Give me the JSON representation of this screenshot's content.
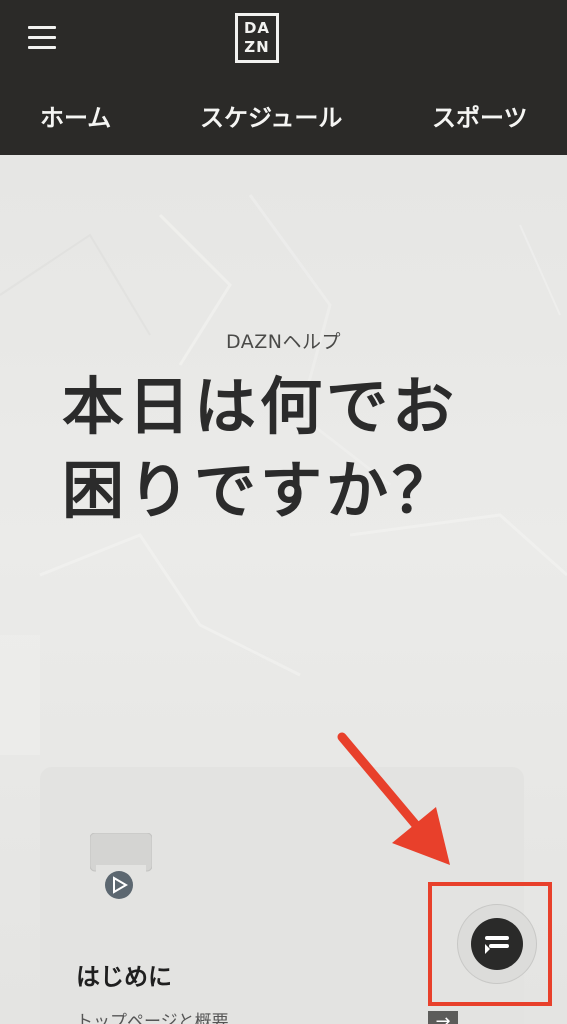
{
  "header": {
    "logo_line1": "DA",
    "logo_line2": "ZN",
    "menu_icon": "hamburger-menu-icon",
    "nav": [
      {
        "label": "ホーム"
      },
      {
        "label": "スケジュール"
      },
      {
        "label": "スポーツ"
      }
    ]
  },
  "hero": {
    "subtitle": "DAZNヘルプ",
    "headline_line1": "本日は何でお",
    "headline_line2": "困りですか？"
  },
  "card": {
    "title": "はじめに",
    "subtext": "トップページと概要",
    "illustration_icon": "play-video-icon",
    "arrow_icon": "arrow-right-icon"
  },
  "chat": {
    "icon": "chat-bubble-icon"
  },
  "annotation": {
    "color": "#e8402b"
  },
  "colors": {
    "header_bg": "#2b2a28",
    "page_bg": "#e9e9e7",
    "text_dark": "#2b2b2b"
  }
}
